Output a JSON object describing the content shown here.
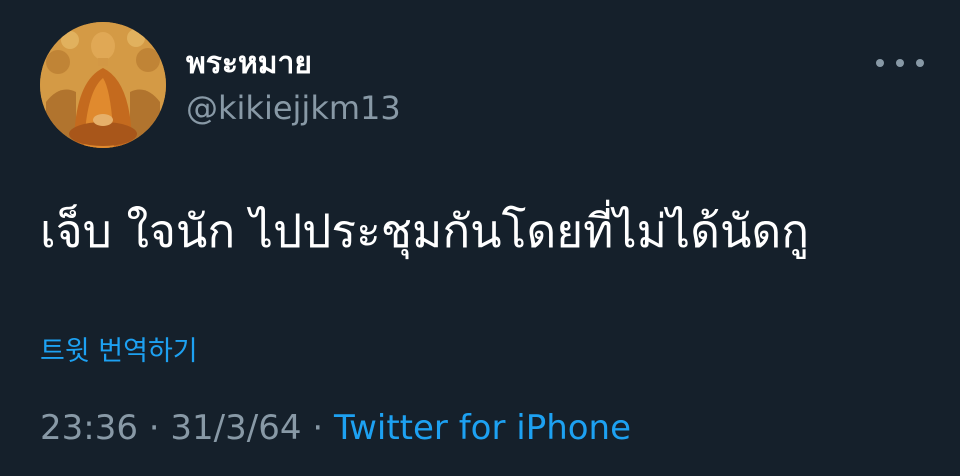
{
  "tweet": {
    "author": {
      "display_name": "พระหมาย",
      "handle": "@kikiejjkm13",
      "avatar_icon": "buddha-avatar"
    },
    "more_icon": "more-horizontal-icon",
    "text": "เจ็บ ใจนัก ไปประชุมกันโดยที่ไม่ได้นัดกู",
    "translate_label": "트윗 번역하기",
    "time": "23:36",
    "separator": "·",
    "date": "31/3/64",
    "source": "Twitter for iPhone"
  },
  "colors": {
    "background": "#15202b",
    "primary_text": "#ffffff",
    "secondary_text": "#8899a6",
    "accent": "#1da1f2"
  }
}
